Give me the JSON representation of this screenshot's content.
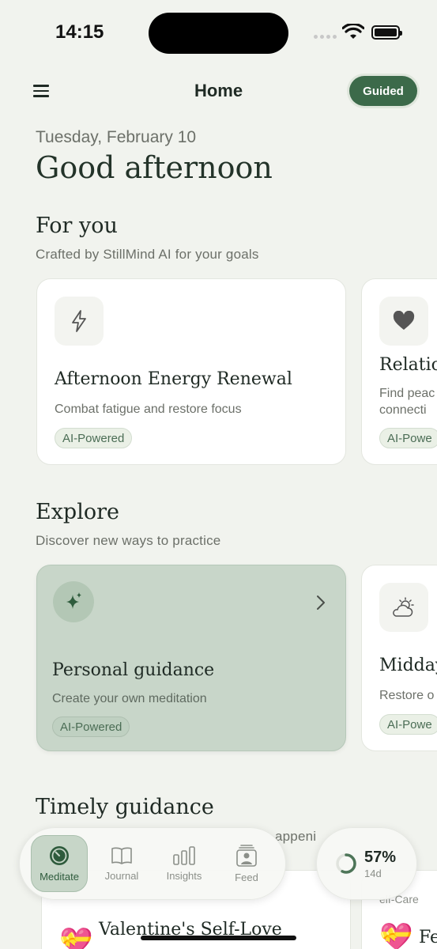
{
  "status_bar": {
    "time": "14:15"
  },
  "header": {
    "title": "Home",
    "guided_label": "Guided"
  },
  "date": "Tuesday, February 10",
  "greeting": "Good afternoon",
  "for_you": {
    "title": "For you",
    "subtitle": "Crafted by StillMind AI for your goals",
    "cards": [
      {
        "icon": "lightning-icon",
        "title": "Afternoon Energy Renewal",
        "subtitle": "Combat fatigue and restore focus",
        "badge": "AI-Powered"
      },
      {
        "icon": "heart-icon",
        "title": "Relatio",
        "subtitle_line1": "Find peac",
        "subtitle_line2": "connecti",
        "badge": "AI-Powe"
      }
    ]
  },
  "explore": {
    "title": "Explore",
    "subtitle": "Discover new ways to practice",
    "cards": [
      {
        "icon": "sparkle-icon",
        "title": "Personal guidance",
        "subtitle": "Create your own meditation",
        "badge": "AI-Powered"
      },
      {
        "icon": "sun-cloud-icon",
        "title": "Midday",
        "subtitle": "Restore o",
        "badge": "AI-Powe"
      }
    ]
  },
  "timely": {
    "title": "Timely guidance",
    "subtitle_partial": "appeni",
    "card_tag": "elf-Care",
    "cards": [
      {
        "icon": "heart-emoji-icon",
        "title": "Valentine's Self-Love"
      },
      {
        "icon": "heart-emoji-icon",
        "title": "Fe"
      }
    ]
  },
  "tab_bar": {
    "tabs": [
      {
        "label": "Meditate",
        "icon": "timer-icon",
        "active": true
      },
      {
        "label": "Journal",
        "icon": "book-icon",
        "active": false
      },
      {
        "label": "Insights",
        "icon": "bar-chart-icon",
        "active": false
      },
      {
        "label": "Feed",
        "icon": "portrait-icon",
        "active": false
      }
    ]
  },
  "progress": {
    "percent_label": "57%",
    "percent": 0.57,
    "days_label": "14d"
  },
  "colors": {
    "accent": "#3c6a4a",
    "background": "#f1f3ee",
    "card_tint": "#c8d6c9"
  }
}
